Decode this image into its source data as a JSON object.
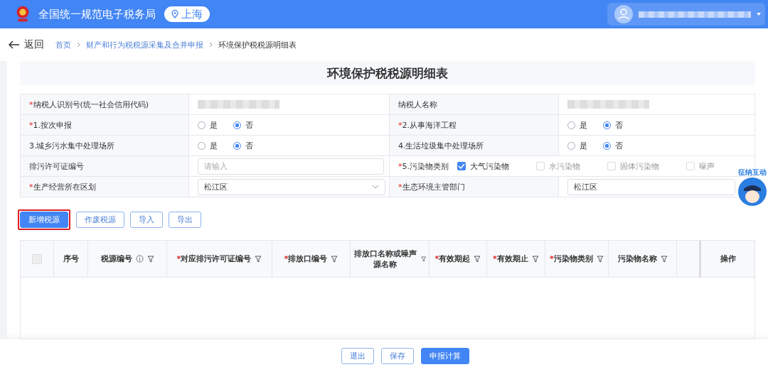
{
  "header": {
    "site_title": "全国统一规范电子税务局",
    "region": "上海"
  },
  "breadcrumb": {
    "back": "返回",
    "items": [
      "首页",
      "财产和行为税税源采集及合并申报",
      "环境保护税税源明细表"
    ]
  },
  "form": {
    "title": "环境保护税税源明细表",
    "rows": [
      {
        "kind": "info",
        "cells": [
          {
            "mark": "*",
            "label": "纳税人识别号(统一社会信用代码)"
          },
          {
            "label": "纳税人名称"
          }
        ]
      },
      {
        "kind": "radio",
        "cells": [
          {
            "mark": "*",
            "label": "1.按次申报",
            "options": [
              {
                "label": "是",
                "selected": false
              },
              {
                "label": "否",
                "selected": true
              }
            ]
          },
          {
            "mark": "*",
            "label": "2.从事海洋工程",
            "options": [
              {
                "label": "是",
                "selected": false
              },
              {
                "label": "否",
                "selected": true
              }
            ]
          }
        ]
      },
      {
        "kind": "radio",
        "cells": [
          {
            "label": "3.城乡污水集中处理场所",
            "options": [
              {
                "label": "是",
                "selected": false
              },
              {
                "label": "否",
                "selected": true
              }
            ]
          },
          {
            "label": "4.生活垃圾集中处理场所",
            "options": [
              {
                "label": "是",
                "selected": false
              },
              {
                "label": "否",
                "selected": true
              }
            ]
          }
        ]
      },
      {
        "kind": "mixed",
        "cells": [
          {
            "label": "排污许可证编号",
            "placeholder": "请输入"
          },
          {
            "mark": "*",
            "label": "5.污染物类别",
            "checks": [
              {
                "label": "大气污染物",
                "checked": true
              },
              {
                "label": "水污染物",
                "checked": false
              },
              {
                "label": "固体污染物",
                "checked": false
              },
              {
                "label": "噪声",
                "checked": false
              }
            ]
          }
        ]
      },
      {
        "kind": "select",
        "cells": [
          {
            "mark": "*",
            "label": "生产经营所在区划",
            "value": "松江区"
          },
          {
            "mark": "*",
            "label": "生态环境主管部门",
            "value": "松江区"
          }
        ]
      }
    ]
  },
  "actions": [
    {
      "label": "新增税源",
      "primary": true,
      "highlighted": true
    },
    {
      "label": "作废税源",
      "primary": false,
      "highlighted": false
    },
    {
      "label": "导入",
      "primary": false,
      "highlighted": false
    },
    {
      "label": "导出",
      "primary": false,
      "highlighted": false
    }
  ],
  "table": {
    "columns": [
      {
        "kind": "check",
        "checked": false
      },
      {
        "label": "序号"
      },
      {
        "label": "税源编号",
        "info": true,
        "filter": true
      },
      {
        "mark": "*",
        "label": "对应排污许可证编号",
        "filter": true
      },
      {
        "mark": "*",
        "label": "排放口编号",
        "filter": true
      },
      {
        "label": "排放口名称或噪声源名称",
        "filter": true
      },
      {
        "mark": "*",
        "label": "有效期起",
        "filter": true
      },
      {
        "mark": "*",
        "label": "有效期止",
        "filter": true
      },
      {
        "mark": "*",
        "label": "污染物类别",
        "filter": true
      },
      {
        "label": "污染物名称",
        "filter": true
      },
      {
        "kind": "cut"
      },
      {
        "label": "操作"
      }
    ]
  },
  "mascot": {
    "caption": "征纳互动"
  },
  "footer": [
    {
      "label": "退出",
      "primary": false
    },
    {
      "label": "保存",
      "primary": false
    },
    {
      "label": "申报计算",
      "primary": true
    }
  ]
}
